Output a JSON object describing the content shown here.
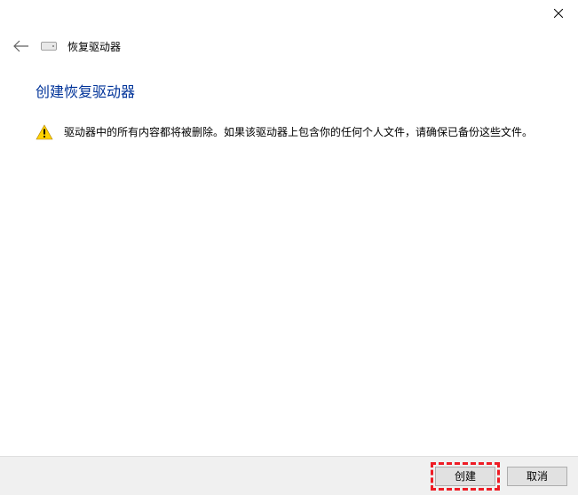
{
  "titlebar": {
    "close_label": "Close"
  },
  "header": {
    "back_label": "Back",
    "drive_label": "恢复驱动器"
  },
  "main": {
    "title": "创建恢复驱动器",
    "warning_text": "驱动器中的所有内容都将被删除。如果该驱动器上包含你的任何个人文件，请确保已备份这些文件。"
  },
  "buttons": {
    "create": "创建",
    "cancel": "取消"
  }
}
